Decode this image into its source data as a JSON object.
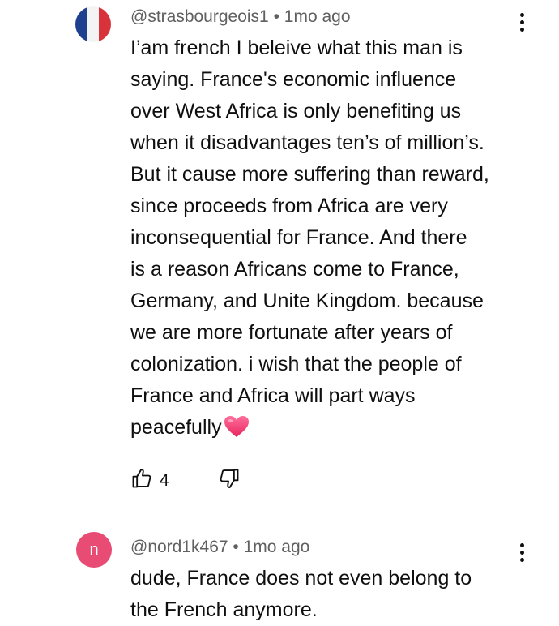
{
  "comments": [
    {
      "handle": "@strasbourgeois1",
      "time": "1mo ago",
      "text": "I’am french I beleive what this man is\nsaying. France's economic influence\nover West Africa is only benefiting us\nwhen it disadvantages ten’s of million’s.\nBut it cause more suffering than reward,\nsince proceeds from Africa are very\ninconsequential for  France. And there\nis a reason Africans come to France,\nGermany, and Unite Kingdom. because\nwe are more fortunate after years of\ncolonization. i wish that the people of\nFrance and Africa will part ways\npeacefully",
      "emoji": "heart-emoji",
      "likes": "4",
      "avatar": "french-flag-avatar",
      "flag_colors": [
        "#1f3f8f",
        "#f4f4f4",
        "#d8323a"
      ]
    },
    {
      "handle": "@nord1k467",
      "time": "1mo ago",
      "text": "dude, France does not even belong to\nthe French anymore.",
      "avatar_letter": "n",
      "avatar_color": "#e84c74"
    }
  ],
  "separator": "•",
  "icons": {
    "like": "thumb-up-icon",
    "dislike": "thumb-down-icon",
    "menu": "more-vert-icon"
  }
}
